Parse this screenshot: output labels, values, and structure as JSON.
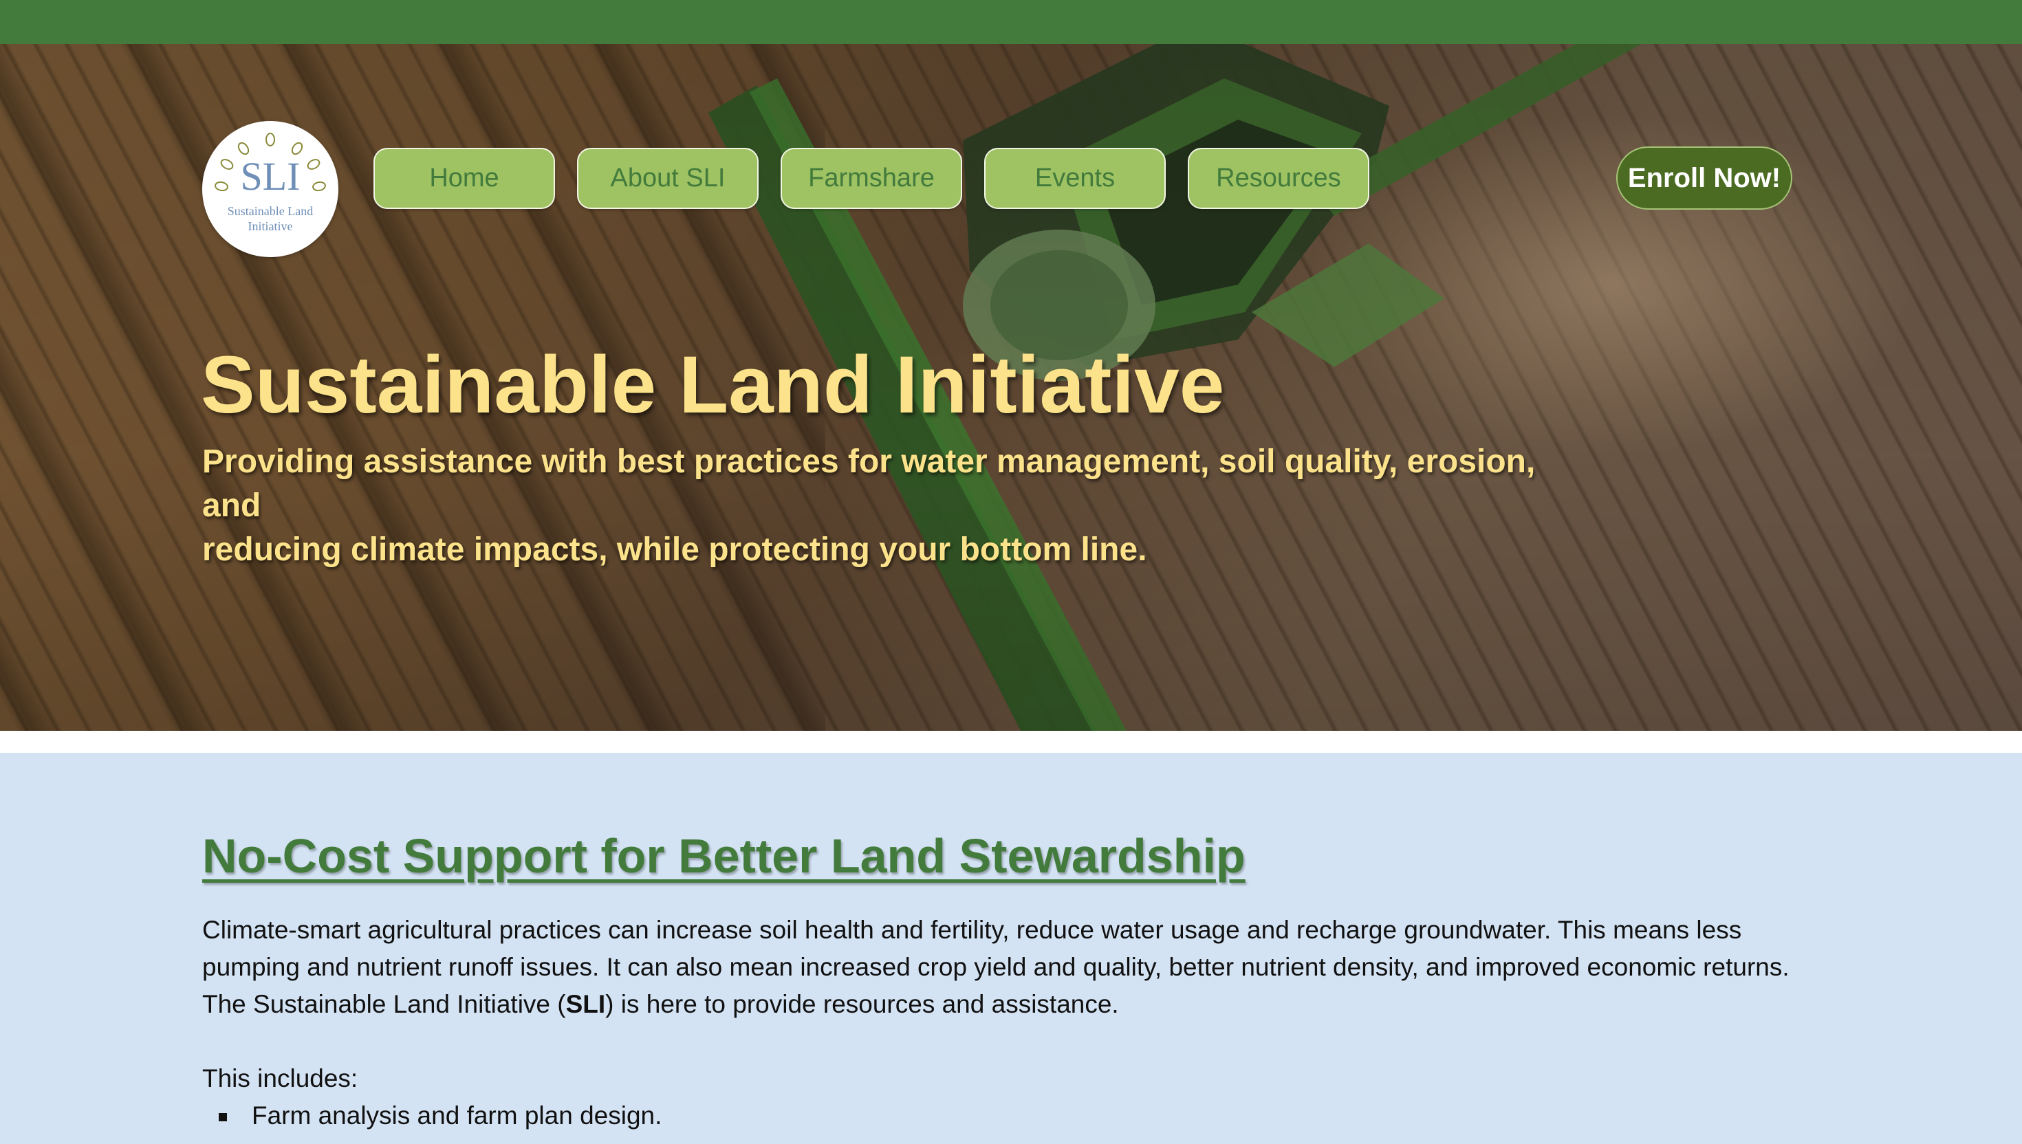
{
  "colors": {
    "topbar": "#427b3c",
    "nav_button_bg": "#9fc263",
    "nav_button_text": "#427b3c",
    "enroll_bg": "#4b6b22",
    "hero_text": "#fbe28b",
    "section_bg": "#d4e3f4",
    "heading": "#427b3c"
  },
  "logo": {
    "abbr": "SLI",
    "name_line1": "Sustainable Land",
    "name_line2": "Initiative"
  },
  "nav": {
    "items": [
      {
        "label": "Home"
      },
      {
        "label": "About SLI"
      },
      {
        "label": "Farmshare"
      },
      {
        "label": "Events"
      },
      {
        "label": "Resources"
      }
    ],
    "cta": "Enroll Now!"
  },
  "hero": {
    "title": "Sustainable Land Initiative",
    "subtitle_line1": "Providing assistance with best practices for water management, soil quality, erosion, and",
    "subtitle_line2": "reducing climate impacts, while protecting your bottom line."
  },
  "support": {
    "heading": "No-Cost Support for Better Land Stewardship",
    "para_line1": "Climate-smart agricultural practices can increase soil health and fertility, reduce water usage and recharge groundwater. This means less",
    "para_line2": "pumping and nutrient runoff issues. It can also mean increased crop yield and quality, better nutrient density, and improved economic returns.",
    "para_line3_prefix": "The Sustainable Land Initiative (",
    "para_line3_bold": "SLI",
    "para_line3_suffix": ") is here to provide resources and assistance.",
    "includes_label": "This includes:",
    "list": [
      "Farm analysis and farm plan design."
    ]
  }
}
